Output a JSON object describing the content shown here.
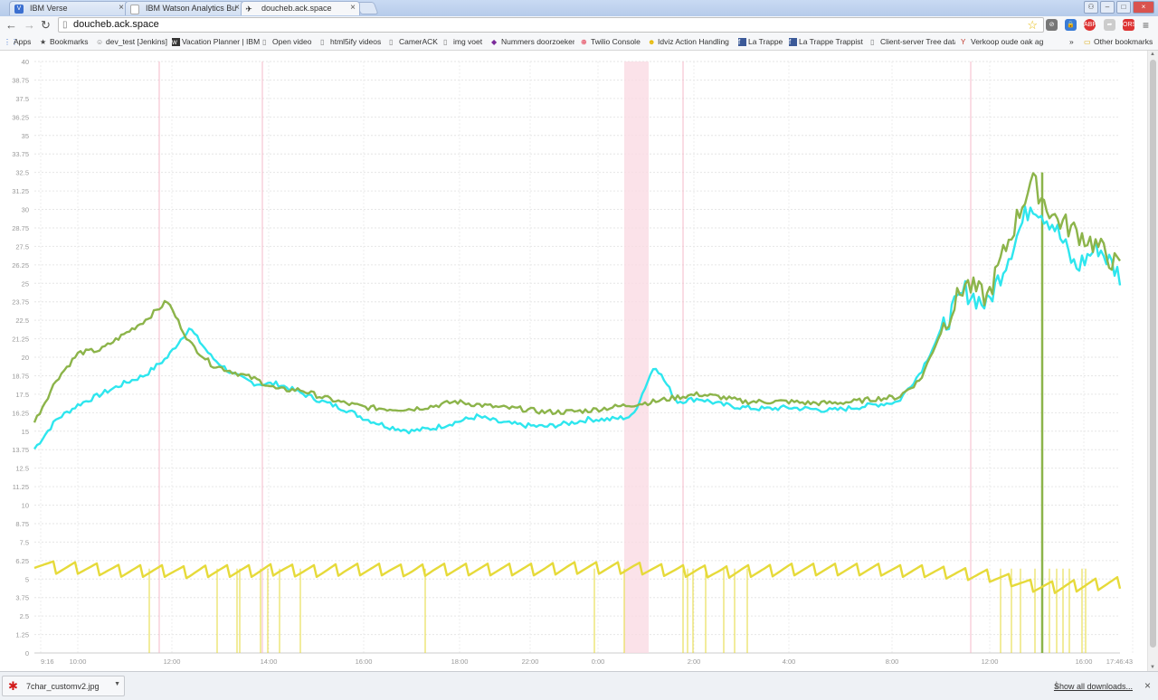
{
  "tabs": [
    {
      "title": "IBM Verse",
      "icon": "V",
      "icon_color": "#3b6fd0"
    },
    {
      "title": "IBM Watson Analytics Bu",
      "icon": "",
      "icon_color": "#aaaaaa"
    },
    {
      "title": "doucheb.ack.space",
      "icon": "",
      "icon_color": "#333333"
    }
  ],
  "address": {
    "url": "doucheb.ack.space"
  },
  "bookmarks": [
    {
      "label": "Apps",
      "icon": "apps-grid-icon"
    },
    {
      "label": "Bookmarks",
      "icon": "star-icon"
    },
    {
      "label": "dev_test [Jenkins]",
      "icon": "jenkins-icon"
    },
    {
      "label": "Vacation Planner | IBM",
      "icon": "page-icon"
    },
    {
      "label": "Open video",
      "icon": "page-icon"
    },
    {
      "label": "html5ify videos",
      "icon": "page-icon"
    },
    {
      "label": "CamerACK",
      "icon": "page-icon"
    },
    {
      "label": "img voet",
      "icon": "page-icon"
    },
    {
      "label": "Nummers doorzoeken",
      "icon": "leaf-icon"
    },
    {
      "label": "Twilio Console",
      "icon": "twilio-icon"
    },
    {
      "label": "Idviz Action Handling",
      "icon": "smiley-icon"
    },
    {
      "label": "La Trappe",
      "icon": "facebook-icon"
    },
    {
      "label": "La Trappe Trappist",
      "icon": "facebook-icon"
    },
    {
      "label": "Client-server Tree data",
      "icon": "page-icon"
    },
    {
      "label": "Verkoop oude oak ag",
      "icon": "glass-icon"
    }
  ],
  "bookmarks_more": "»",
  "other_bookmarks": "Other bookmarks",
  "chart_data": {
    "type": "line",
    "y_ticks": [
      "0",
      "1.25",
      "2.5",
      "3.75",
      "5",
      "6.25",
      "7.5",
      "8.75",
      "10",
      "11.25",
      "12.5",
      "13.75",
      "15",
      "16.25",
      "17.5",
      "18.75",
      "20",
      "21.25",
      "22.5",
      "23.75",
      "25",
      "26.25",
      "27.5",
      "28.75",
      "30",
      "31.25",
      "32.5",
      "33.75",
      "35",
      "36.25",
      "37.5",
      "38.75",
      "40"
    ],
    "ylim": [
      0,
      40
    ],
    "x_ticks": [
      "9:16",
      "10:00",
      "12:00",
      "14:00",
      "16:00",
      "18:00",
      "22:00",
      "0:00",
      "2:00",
      "4:00",
      "8:00",
      "12:00",
      "16:00",
      "17:46:43"
    ],
    "grid": true,
    "colors": {
      "cyan": "#2ee6ee",
      "green": "#8cb44a",
      "yellow": "#e6da3a",
      "marker": "#f5b8c8"
    },
    "series": [
      {
        "color": "#2ee6ee",
        "values": [
          13.8,
          15.8,
          16.8,
          17.5,
          18.2,
          18.8,
          20.0,
          22.0,
          20.0,
          18.8,
          18.2,
          18.2,
          17.6,
          17.0,
          16.5,
          15.8,
          15.3,
          15.0,
          15.2,
          15.6,
          16.0,
          15.6,
          15.4,
          15.3,
          15.5,
          15.8,
          15.8,
          16.0,
          19.5,
          17.0,
          17.2,
          16.8,
          16.6,
          16.5,
          16.6,
          16.5,
          16.4,
          16.6,
          16.8,
          17.0,
          19.0,
          22.0,
          24.5,
          23.5,
          27.0,
          30.5,
          29.0,
          26.0,
          27.5,
          25.5
        ]
      },
      {
        "color": "#8cb44a",
        "values": [
          15.6,
          18.5,
          20.3,
          20.5,
          21.5,
          22.5,
          23.8,
          21.0,
          19.5,
          19.0,
          18.5,
          17.8,
          17.8,
          17.3,
          16.9,
          16.6,
          16.5,
          16.5,
          16.7,
          17.0,
          16.8,
          16.6,
          16.5,
          16.3,
          16.3,
          16.4,
          16.6,
          16.8,
          17.0,
          17.3,
          17.5,
          17.3,
          17.0,
          17.0,
          17.0,
          16.9,
          16.9,
          17.0,
          17.2,
          17.3,
          18.5,
          22.0,
          25.0,
          24.0,
          28.0,
          32.0,
          29.5,
          28.5,
          27.5,
          26.0
        ]
      },
      {
        "color": "#e6da3a",
        "values": [
          6.2,
          5.8,
          5.8,
          5.7,
          5.6,
          5.6,
          5.6,
          5.5,
          5.6,
          5.6,
          5.6,
          5.7,
          5.6,
          5.6,
          5.7,
          5.7,
          5.7,
          5.6,
          5.7,
          5.7,
          5.7,
          5.7,
          5.7,
          5.7,
          5.8,
          5.8,
          5.8,
          5.8,
          5.7,
          5.6,
          5.6,
          5.5,
          5.6,
          5.6,
          5.7,
          5.7,
          5.7,
          5.7,
          5.7,
          5.6,
          5.6,
          5.5,
          5.4,
          5.3,
          5.0,
          4.6,
          4.5,
          4.6,
          4.7,
          4.8
        ]
      }
    ]
  },
  "downloads": {
    "filename": "7char_customv2.jpg",
    "show_all": "Show all downloads..."
  }
}
